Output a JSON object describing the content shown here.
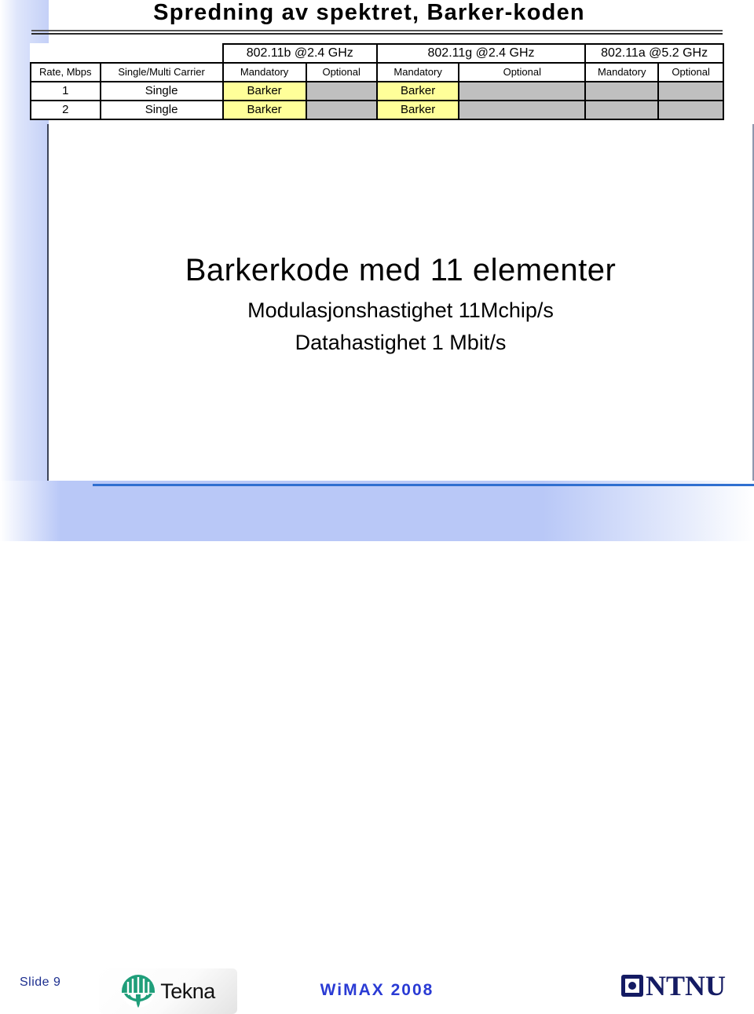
{
  "slide": {
    "title": "Spredning av spektret, Barker-koden"
  },
  "spec_table": {
    "band_headers": [
      "802.11b @2.4 GHz",
      "802.11g @2.4 GHz",
      "802.11a @5.2 GHz"
    ],
    "sub_headers": {
      "rate": "Rate, Mbps",
      "carrier": "Single/Multi Carrier",
      "b_mandatory": "Mandatory",
      "b_optional": "Optional",
      "g_mandatory": "Mandatory",
      "g_optional": "Optional",
      "a_mandatory": "Mandatory",
      "a_optional": "Optional"
    },
    "rows": [
      {
        "rate": "1",
        "carrier": "Single",
        "b_mandatory": "Barker",
        "b_optional": "",
        "g_mandatory": "Barker",
        "g_optional": "",
        "a_mandatory": "",
        "a_optional": ""
      },
      {
        "rate": "2",
        "carrier": "Single",
        "b_mandatory": "Barker",
        "b_optional": "",
        "g_mandatory": "Barker",
        "g_optional": "",
        "a_mandatory": "",
        "a_optional": ""
      }
    ]
  },
  "body": {
    "heading": "Barkerkode med 11 elementer",
    "line_1": "Modulasjonshastighet 11Mchip/s",
    "line_2": "Datahastighet 1 Mbit/s"
  },
  "footer": {
    "slide_number": "Slide  9",
    "tekna_label": "Tekna",
    "conference": "WiMAX 2008",
    "ntnu_label": "NTNU"
  },
  "colors": {
    "highlight_yellow": "#ffff99",
    "disabled_gray": "#bfbfbf",
    "footer_blue": "#b9c8f7",
    "conference_blue": "#2a3bd4",
    "ntnu_navy": "#141b63",
    "tekna_green": "#1f9e7a"
  }
}
